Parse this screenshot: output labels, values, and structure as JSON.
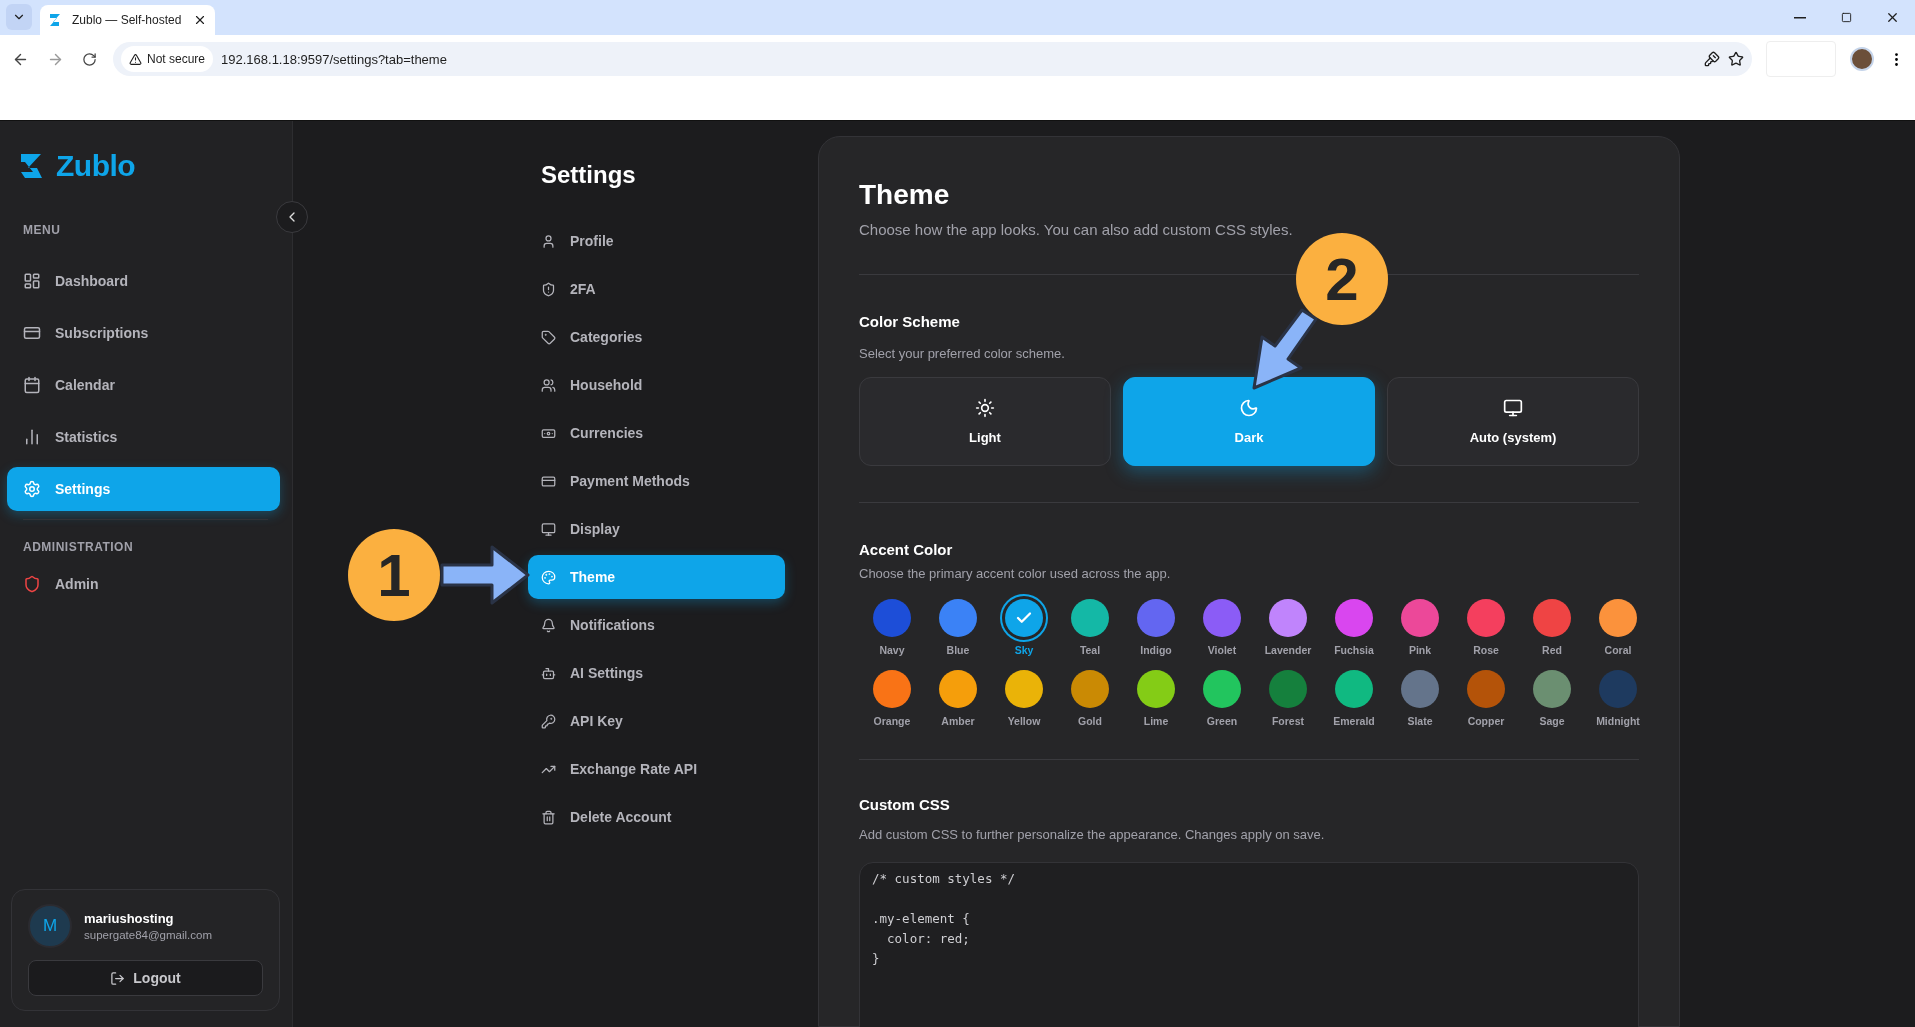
{
  "browser": {
    "tab_title": "Zublo — Self-hosted",
    "security": "Not secure",
    "url": "192.168.1.18:9597/settings?tab=theme"
  },
  "sidebar": {
    "logo": "Zublo",
    "menu_heading": "MENU",
    "items": [
      {
        "label": "Dashboard",
        "selected": false
      },
      {
        "label": "Subscriptions",
        "selected": false
      },
      {
        "label": "Calendar",
        "selected": false
      },
      {
        "label": "Statistics",
        "selected": false
      },
      {
        "label": "Settings",
        "selected": true
      }
    ],
    "admin_heading": "ADMINISTRATION",
    "admin_items": [
      {
        "label": "Admin",
        "selected": false
      }
    ],
    "user": {
      "initial": "M",
      "name": "mariushosting",
      "email": "supergate84@gmail.com"
    },
    "logout": "Logout"
  },
  "settings_nav": {
    "title": "Settings",
    "items": [
      {
        "label": "Profile",
        "selected": false
      },
      {
        "label": "2FA",
        "selected": false
      },
      {
        "label": "Categories",
        "selected": false
      },
      {
        "label": "Household",
        "selected": false
      },
      {
        "label": "Currencies",
        "selected": false
      },
      {
        "label": "Payment Methods",
        "selected": false
      },
      {
        "label": "Display",
        "selected": false
      },
      {
        "label": "Theme",
        "selected": true
      },
      {
        "label": "Notifications",
        "selected": false
      },
      {
        "label": "AI Settings",
        "selected": false
      },
      {
        "label": "API Key",
        "selected": false
      },
      {
        "label": "Exchange Rate API",
        "selected": false
      },
      {
        "label": "Delete Account",
        "selected": false
      }
    ]
  },
  "theme": {
    "title": "Theme",
    "description": "Choose how the app looks. You can also add custom CSS styles.",
    "color_scheme": {
      "title": "Color Scheme",
      "description": "Select your preferred color scheme.",
      "options": [
        {
          "label": "Light",
          "selected": false
        },
        {
          "label": "Dark",
          "selected": true
        },
        {
          "label": "Auto (system)",
          "selected": false
        }
      ]
    },
    "accent_color": {
      "title": "Accent Color",
      "description": "Choose the primary accent color used across the app.",
      "swatches": [
        {
          "label": "Navy",
          "color": "#1d4ed8",
          "selected": false
        },
        {
          "label": "Blue",
          "color": "#3b82f6",
          "selected": false
        },
        {
          "label": "Sky",
          "color": "#0ea5e9",
          "selected": true
        },
        {
          "label": "Teal",
          "color": "#14b8a6",
          "selected": false
        },
        {
          "label": "Indigo",
          "color": "#6366f1",
          "selected": false
        },
        {
          "label": "Violet",
          "color": "#8b5cf6",
          "selected": false
        },
        {
          "label": "Lavender",
          "color": "#c084fc",
          "selected": false
        },
        {
          "label": "Fuchsia",
          "color": "#d946ef",
          "selected": false
        },
        {
          "label": "Pink",
          "color": "#ec4899",
          "selected": false
        },
        {
          "label": "Rose",
          "color": "#f43f5e",
          "selected": false
        },
        {
          "label": "Red",
          "color": "#ef4444",
          "selected": false
        },
        {
          "label": "Coral",
          "color": "#fb923c",
          "selected": false
        },
        {
          "label": "Orange",
          "color": "#f97316",
          "selected": false
        },
        {
          "label": "Amber",
          "color": "#f59e0b",
          "selected": false
        },
        {
          "label": "Yellow",
          "color": "#eab308",
          "selected": false
        },
        {
          "label": "Gold",
          "color": "#ca8a04",
          "selected": false
        },
        {
          "label": "Lime",
          "color": "#84cc16",
          "selected": false
        },
        {
          "label": "Green",
          "color": "#22c55e",
          "selected": false
        },
        {
          "label": "Forest",
          "color": "#15803d",
          "selected": false
        },
        {
          "label": "Emerald",
          "color": "#10b981",
          "selected": false
        },
        {
          "label": "Slate",
          "color": "#64748b",
          "selected": false
        },
        {
          "label": "Copper",
          "color": "#b45309",
          "selected": false
        },
        {
          "label": "Sage",
          "color": "#6b8f71",
          "selected": false
        },
        {
          "label": "Midnight",
          "color": "#1e3a5f",
          "selected": false
        }
      ]
    },
    "custom_css": {
      "title": "Custom CSS",
      "description": "Add custom CSS to further personalize the appearance. Changes apply on save.",
      "value": "/* custom styles */\n\n.my-element {\n  color: red;\n}"
    }
  },
  "annotations": [
    {
      "label": "1"
    },
    {
      "label": "2"
    }
  ]
}
